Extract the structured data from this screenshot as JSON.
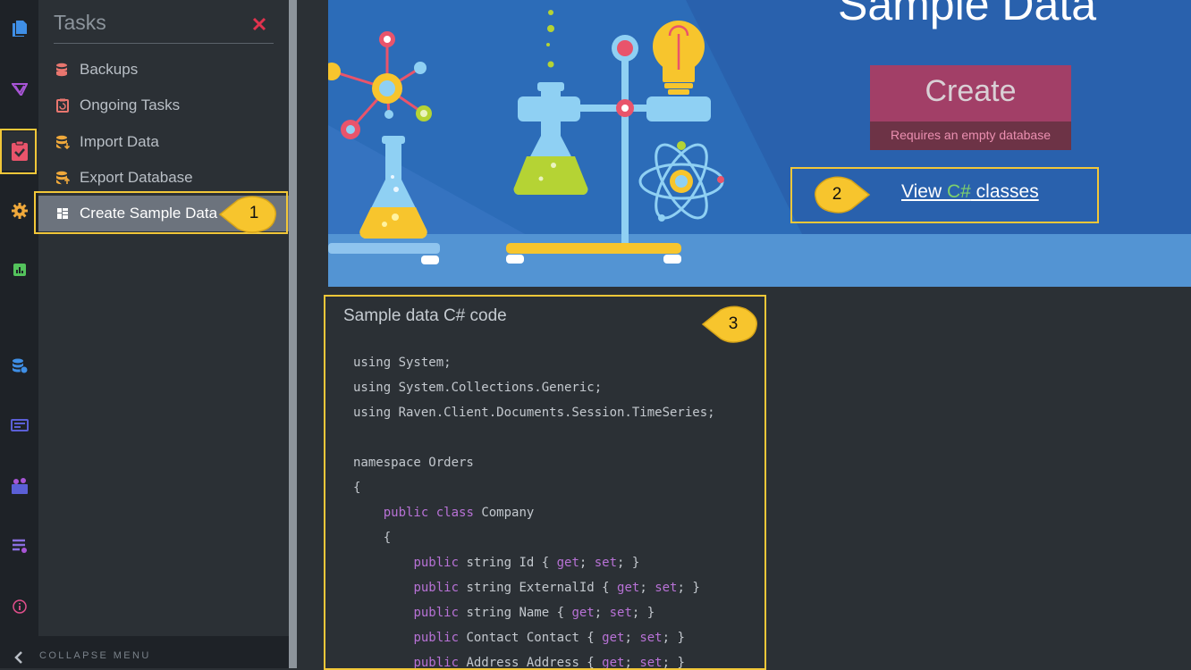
{
  "sidebar": {
    "rail_icons": [
      "documents-icon",
      "indexes-icon",
      "tasks-icon",
      "settings-icon",
      "stats-icon",
      "databases-icon",
      "manage-server-icon",
      "cluster-icon",
      "server-settings-icon",
      "about-icon"
    ],
    "tasks": {
      "title": "Tasks",
      "items": [
        {
          "label": "Backups",
          "icon": "backup-icon",
          "color": "#e9766f"
        },
        {
          "label": "Ongoing Tasks",
          "icon": "ongoing-tasks-icon",
          "color": "#e9766f"
        },
        {
          "label": "Import Data",
          "icon": "import-icon",
          "color": "#f0a93b"
        },
        {
          "label": "Export Database",
          "icon": "export-icon",
          "color": "#f0a93b"
        },
        {
          "label": "Create Sample Data",
          "icon": "sample-data-icon",
          "color": "#ffffff",
          "active": true
        }
      ]
    },
    "collapse_label": "COLLAPSE MENU"
  },
  "hero": {
    "title": "Sample Data",
    "create_button": {
      "label": "Create",
      "sublabel": "Requires an empty database"
    },
    "view_classes": {
      "prefix": "View ",
      "lang": "C#",
      "suffix": " classes"
    }
  },
  "callouts": [
    "1",
    "2",
    "3"
  ],
  "code_panel": {
    "title": "Sample data C# code",
    "lines": [
      "using System;",
      "using System.Collections.Generic;",
      "using Raven.Client.Documents.Session.TimeSeries;",
      "",
      "namespace Orders",
      "{",
      "    public class Company",
      "    {",
      "        public string Id { get; set; }",
      "        public string ExternalId { get; set; }",
      "        public string Name { get; set; }",
      "        public Contact Contact { get; set; }",
      "        public Address Address { get; set; }"
    ]
  },
  "colors": {
    "highlight": "#f2c739",
    "hero_bg": "#2961ad",
    "create_bg": "#a23f67",
    "keyword": "#b872d6"
  }
}
